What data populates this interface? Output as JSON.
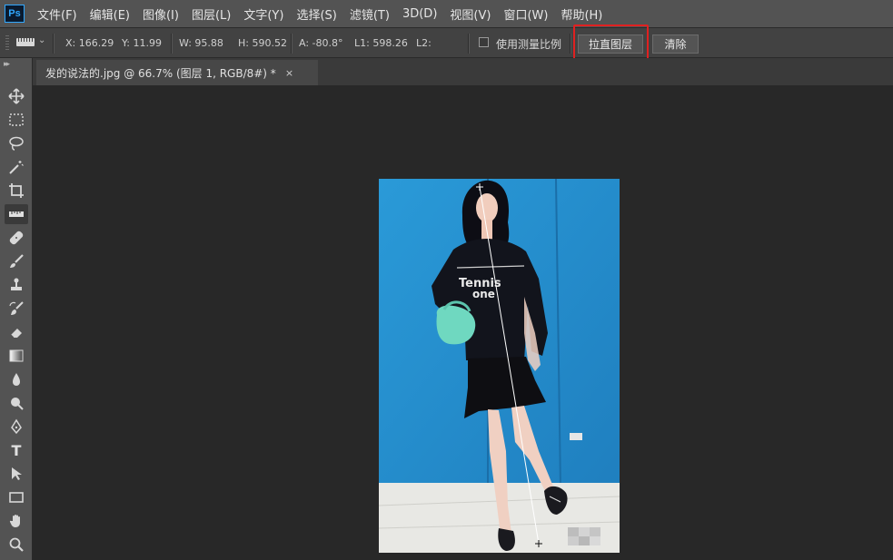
{
  "menubar": {
    "logo": "Ps",
    "items": [
      "文件(F)",
      "编辑(E)",
      "图像(I)",
      "图层(L)",
      "文字(Y)",
      "选择(S)",
      "滤镜(T)",
      "3D(D)",
      "视图(V)",
      "窗口(W)",
      "帮助(H)"
    ]
  },
  "options": {
    "x": "X: 166.29",
    "y": "Y: 11.99",
    "w": "W: 95.88",
    "h": "H: 590.52",
    "a": "A: -80.8°",
    "l1": "L1: 598.26",
    "l2": "L2:",
    "use_scale_label": "使用测量比例",
    "straighten_button": "拉直图层",
    "clear_button": "清除"
  },
  "document": {
    "tab_title": "发的说法的.jpg @ 66.7% (图层 1, RGB/8#) *",
    "close": "×",
    "image_text": "Tennis one"
  },
  "colors": {
    "highlight": "#e02020",
    "image_background": "#2795cf",
    "ps_blue": "#31a8ff"
  },
  "toolbox": {
    "collapse": "▸▸",
    "tools": [
      "move-icon",
      "marquee-icon",
      "lasso-icon",
      "magic-wand-icon",
      "crop-icon",
      "ruler-icon",
      "healing-icon",
      "brush-icon",
      "stamp-icon",
      "history-brush-icon",
      "eraser-icon",
      "gradient-icon",
      "blur-icon",
      "dodge-icon",
      "pen-icon",
      "text-icon",
      "path-select-icon",
      "rectangle-icon",
      "hand-icon",
      "zoom-icon"
    ],
    "text_tool": "T"
  }
}
